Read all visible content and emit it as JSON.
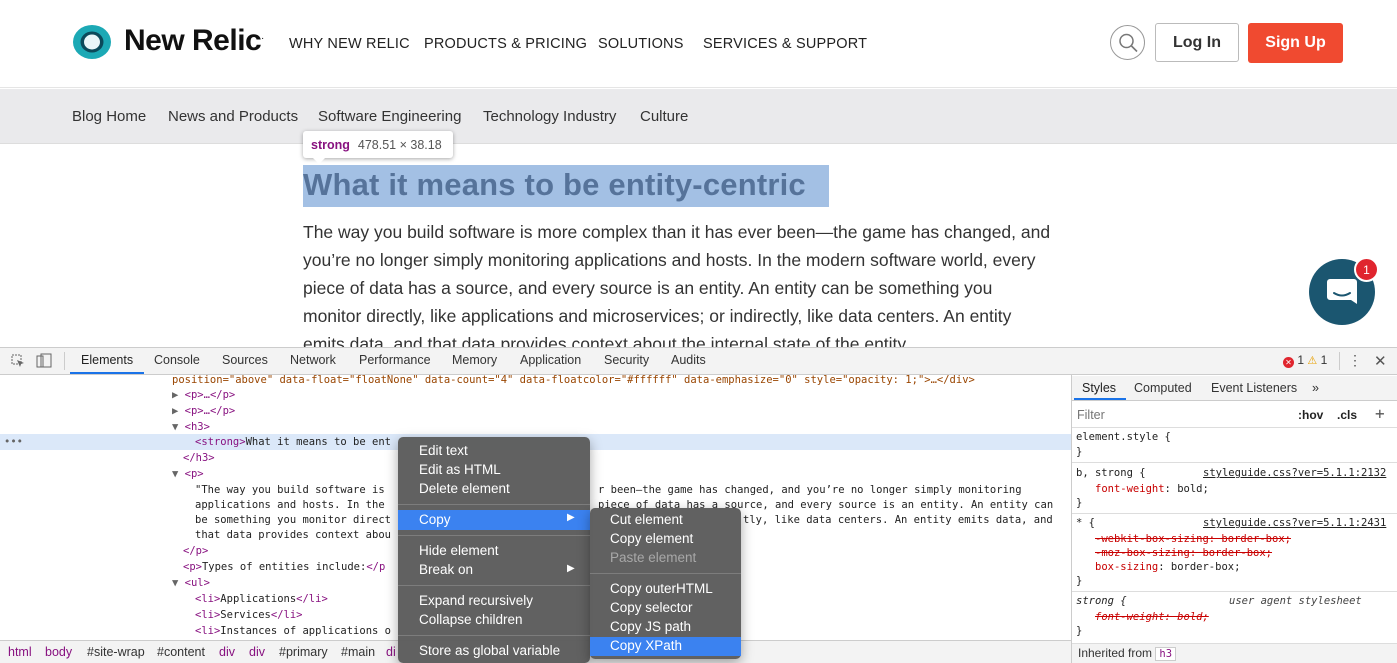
{
  "site": {
    "logo_text": "New Relic",
    "logo_reg": ".",
    "nav": [
      "WHY NEW RELIC",
      "PRODUCTS & PRICING",
      "SOLUTIONS",
      "SERVICES & SUPPORT"
    ],
    "login": "Log In",
    "signup": "Sign Up",
    "colors": {
      "brand_teal": "#1ca9b5",
      "signup_red": "#f04a30"
    }
  },
  "blog_nav": [
    "Blog Home",
    "News and Products",
    "Software Engineering",
    "Technology Industry",
    "Culture"
  ],
  "tooltip": {
    "tag": "strong",
    "dims": "478.51 × 38.18"
  },
  "article": {
    "heading": "What it means to be entity-centric",
    "lines": [
      "The way you build software is more complex than it has ever been—the game has changed, and",
      "you’re no longer simply monitoring applications and hosts. In the modern software world, every",
      "piece of data has a source, and every source is an entity. An entity can be something you",
      "monitor directly, like applications and microservices; or indirectly, like data centers. An entity",
      "emits data, and that data provides context about the internal state of the entity."
    ]
  },
  "chat": {
    "badge": "1"
  },
  "devtools": {
    "tabs": [
      "Elements",
      "Console",
      "Sources",
      "Network",
      "Performance",
      "Memory",
      "Application",
      "Security",
      "Audits"
    ],
    "errors": "1",
    "warnings": "1",
    "code": {
      "l0": "position=\"above\" data-float=\"floatNone\" data-count=\"4\" data-floatcolor=\"#ffffff\" data-emphasize=\"0\" style=\"opacity: 1;\">…</div>",
      "l1": "<p>…</p>",
      "l2": "<p>…</p>",
      "l3": "<h3>",
      "l4a": "<strong>",
      "l4b": "What it means to be ent",
      "l5": "</h3>",
      "l6": "<p>",
      "l7a": "\"The way you build software is",
      "l7b": "r been—the game has changed, and you’re no longer simply monitoring",
      "l8a": "applications and hosts. In the",
      "l8b": "piece of data has a source, and every source is an entity. An entity can",
      "l9a": "be something you monitor direct",
      "l9b": "tly, like data centers. An entity emits data, and",
      "l10a": "that data provides context abou",
      "l11": "</p>",
      "l12a": "<p>",
      "l12b": "Types of entities include:",
      "l12c": "</p",
      "l13": "<ul>",
      "l14a": "<li>",
      "l14b": "Applications",
      "l14c": "</li>",
      "l15a": "<li>",
      "l15b": "Services",
      "l15c": "</li>",
      "l16a": "<li>",
      "l16b": "Instances of applications o"
    },
    "breadcrumb": [
      "html",
      "body",
      "#site-wrap",
      "#content",
      "div",
      "div",
      "#primary",
      "#main",
      "di"
    ],
    "styles": {
      "tabs": [
        "Styles",
        "Computed",
        "Event Listeners",
        "»"
      ],
      "filter_placeholder": "Filter",
      "hov": ":hov",
      "cls": ".cls",
      "plus": "+",
      "r1_sel": "element.style {",
      "r1_end": "}",
      "r2_sel": "b, strong {",
      "r2_src": "styleguide.css?ver=5.1.1:2132",
      "r2_prop": "font-weight",
      "r2_val": "bold;",
      "r2_end": "}",
      "r3_sel": "* {",
      "r3_src": "styleguide.css?ver=5.1.1:2431",
      "r3_p1": "-webkit-box-sizing: border-box;",
      "r3_p2": "-moz-box-sizing: border-box;",
      "r3_p3_prop": "box-sizing",
      "r3_p3_val": "border-box;",
      "r3_end": "}",
      "r4_sel": "strong {",
      "r4_src": "user agent stylesheet",
      "r4_p1": "font-weight: bold;",
      "r4_end": "}",
      "inherited_label": "Inherited from",
      "inherited_tag": "h3"
    }
  },
  "context_menu": {
    "items": [
      "Edit text",
      "Edit as HTML",
      "Delete element",
      "Copy",
      "Hide element",
      "Break on",
      "Expand recursively",
      "Collapse children",
      "Store as global variable"
    ],
    "submenu": [
      "Cut element",
      "Copy element",
      "Paste element",
      "Copy outerHTML",
      "Copy selector",
      "Copy JS path",
      "Copy XPath"
    ]
  }
}
